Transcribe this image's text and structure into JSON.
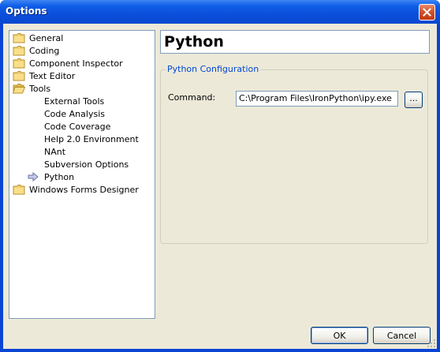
{
  "window": {
    "title": "Options"
  },
  "tree": {
    "items": [
      {
        "label": "General",
        "icon": "folder-icon",
        "indent": 0
      },
      {
        "label": "Coding",
        "icon": "folder-icon",
        "indent": 0
      },
      {
        "label": "Component Inspector",
        "icon": "folder-icon",
        "indent": 0
      },
      {
        "label": "Text Editor",
        "icon": "folder-icon",
        "indent": 0
      },
      {
        "label": "Tools",
        "icon": "open-folder-icon",
        "indent": 0
      },
      {
        "label": "External Tools",
        "icon": "",
        "indent": 1
      },
      {
        "label": "Code Analysis",
        "icon": "",
        "indent": 1
      },
      {
        "label": "Code Coverage",
        "icon": "",
        "indent": 1
      },
      {
        "label": "Help 2.0 Environment",
        "icon": "",
        "indent": 1
      },
      {
        "label": "NAnt",
        "icon": "",
        "indent": 1
      },
      {
        "label": "Subversion Options",
        "icon": "",
        "indent": 1
      },
      {
        "label": "Python",
        "icon": "arrow-right-icon",
        "indent": 1,
        "selected": true
      },
      {
        "label": "Windows Forms Designer",
        "icon": "folder-icon",
        "indent": 0
      }
    ]
  },
  "panel": {
    "title": "Python",
    "group_title": "Python Configuration",
    "command_label": "Command:",
    "command_value": "C:\\Program Files\\IronPython\\ipy.exe",
    "browse_label": "..."
  },
  "buttons": {
    "ok": "OK",
    "cancel": "Cancel"
  },
  "colors": {
    "titlebar": "#0a49d0",
    "accent": "#0046d5",
    "dialog_bg": "#ece9d8"
  }
}
